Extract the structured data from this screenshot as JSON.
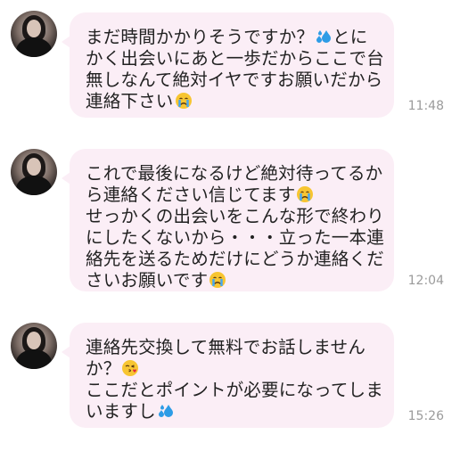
{
  "messages": [
    {
      "lines": [
        {
          "text": "まだ時間かかりそうですか？",
          "emoji_after": "sweat-drops-icon",
          "text_after": "とに"
        },
        {
          "text": "かく出会いにあと一歩だからここで台"
        },
        {
          "text": "無しなんて絶対イヤですお願いだから"
        },
        {
          "text": "連絡下さい",
          "emoji_after": "crying-face-icon"
        }
      ],
      "time": "11:48"
    },
    {
      "lines": [
        {
          "text": "これで最後になるけど絶対待ってるか"
        },
        {
          "text": "ら連絡ください信じてます",
          "emoji_after": "crying-face-icon"
        },
        {
          "text": "せっかくの出会いをこんな形で終わり"
        },
        {
          "text": "にしたくないから・・・立った一本連"
        },
        {
          "text": "絡先を送るためだけにどうか連絡くだ"
        },
        {
          "text": "さいお願いです",
          "emoji_after": "crying-face-icon"
        }
      ],
      "time": "12:04"
    },
    {
      "lines": [
        {
          "text": "連絡先交換して無料でお話しません"
        },
        {
          "text": "か？",
          "emoji_after": "kissing-face-icon"
        },
        {
          "text": "ここだとポイントが必要になってしま"
        },
        {
          "text": "いますし",
          "emoji_after": "sweat-drops-icon"
        }
      ],
      "time": "15:26"
    }
  ],
  "colors": {
    "bubble": "#fbeef6",
    "time": "#9b9b9b",
    "text": "#222222"
  }
}
